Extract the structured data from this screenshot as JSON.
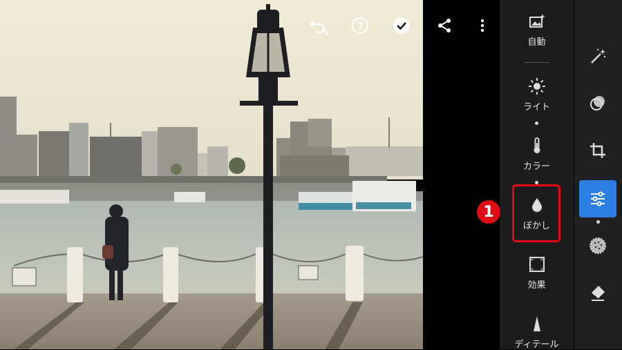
{
  "topbar": {
    "undo_icon": "undo-icon",
    "help_icon": "help-icon",
    "done_icon": "check-circle-icon",
    "share_icon": "share-icon",
    "more_icon": "more-vertical-icon"
  },
  "panel": {
    "items": [
      {
        "label": "自動",
        "icon": "auto-image-icon"
      },
      {
        "label": "ライト",
        "icon": "sun-icon"
      },
      {
        "label": "カラー",
        "icon": "thermometer-icon"
      },
      {
        "label": "ぼかし",
        "icon": "droplet-icon"
      },
      {
        "label": "効果",
        "icon": "vignette-icon"
      },
      {
        "label": "ディテール",
        "icon": "triangle-icon"
      }
    ],
    "selected": "ぼかし"
  },
  "annotation": {
    "badge": "1",
    "color": "#e00b14"
  },
  "sidebar": {
    "tools": [
      "magic-wand-icon",
      "circles-icon",
      "crop-icon",
      "sliders-icon",
      "dotted-circle-icon",
      "eraser-icon"
    ],
    "active": "sliders-icon",
    "accent": "#2d7fe6"
  }
}
